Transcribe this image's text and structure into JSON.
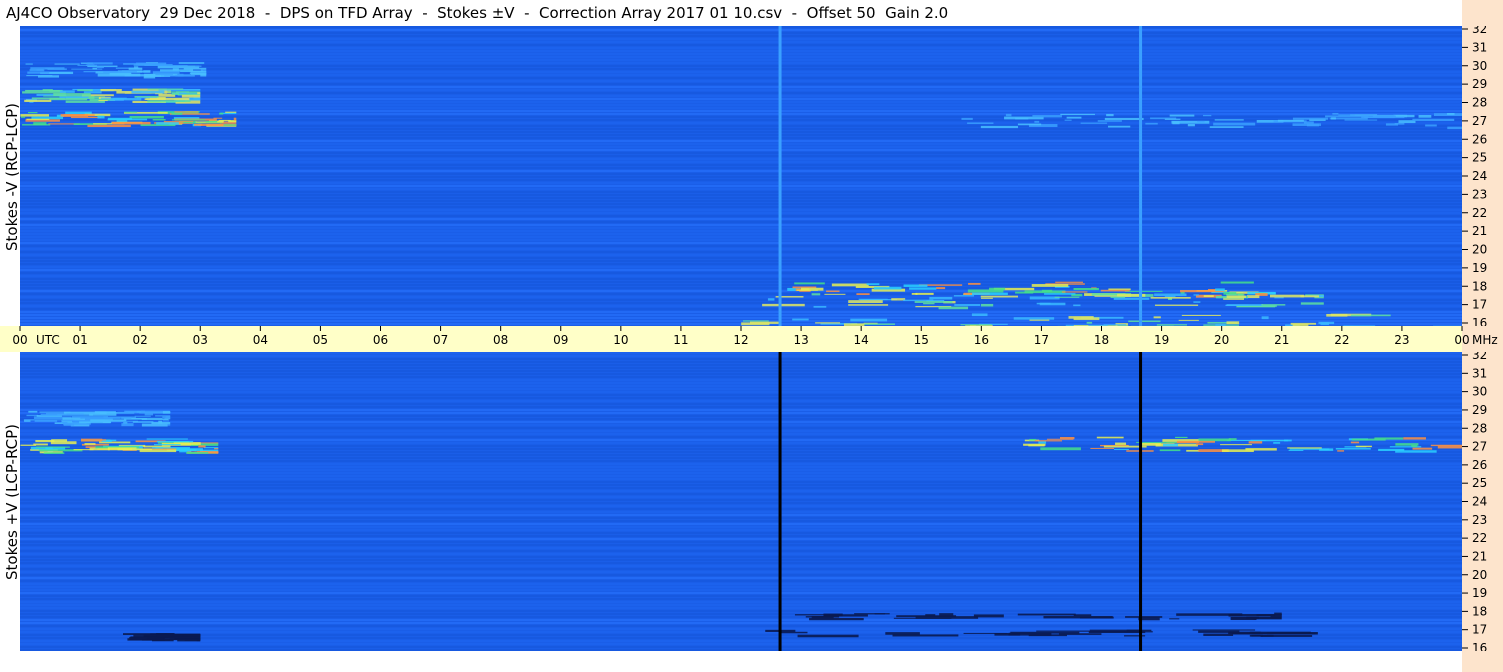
{
  "title": "AJ4CO Observatory  29 Dec 2018  -  DPS on TFD Array  -  Stokes ±V  -  Correction Array 2017 01 10.csv  -  Offset 50  Gain 2.0",
  "colors": {
    "background_blue": "#1a5ee8",
    "band_cyan": "#3aa0ff",
    "axis_bg": "#ffffc8",
    "side_bg": "#fde4cc"
  },
  "chart_data": [
    {
      "type": "heatmap",
      "panel": "top",
      "ylabel": "Stokes -V (RCP-LCP)",
      "x_axis": {
        "label": "UTC",
        "ticks": [
          "00",
          "01",
          "02",
          "03",
          "04",
          "05",
          "06",
          "07",
          "08",
          "09",
          "10",
          "11",
          "12",
          "13",
          "14",
          "15",
          "16",
          "17",
          "18",
          "19",
          "20",
          "21",
          "22",
          "23",
          "00"
        ],
        "range": [
          0,
          24
        ]
      },
      "y_axis": {
        "unit": "MHz",
        "ticks": [
          "16",
          "17",
          "18",
          "19",
          "20",
          "21",
          "22",
          "23",
          "24",
          "25",
          "26",
          "27",
          "28",
          "29",
          "30",
          "31",
          "32"
        ],
        "range": [
          16,
          32
        ]
      },
      "features": [
        {
          "kind": "activity_band",
          "freq": 27.1,
          "t_start": 0.0,
          "t_end": 3.6,
          "intensity": "high"
        },
        {
          "kind": "activity_band",
          "freq": 28.3,
          "t_start": 0.0,
          "t_end": 3.0,
          "intensity": "medium"
        },
        {
          "kind": "activity_band",
          "freq": 29.7,
          "t_start": 0.0,
          "t_end": 3.1,
          "intensity": "low"
        },
        {
          "kind": "activity_band",
          "freq": 18.0,
          "t_start": 12.6,
          "t_end": 20.9,
          "intensity": "high"
        },
        {
          "kind": "activity_band",
          "freq": 17.4,
          "t_start": 12.3,
          "t_end": 21.7,
          "intensity": "medium"
        },
        {
          "kind": "activity_band",
          "freq": 16.3,
          "t_start": 12.0,
          "t_end": 24.0,
          "intensity": "medium"
        },
        {
          "kind": "activity_band",
          "freq": 27.0,
          "t_start": 15.6,
          "t_end": 24.0,
          "intensity": "low"
        },
        {
          "kind": "vertical_line",
          "t": 12.65
        },
        {
          "kind": "vertical_line",
          "t": 18.65
        }
      ]
    },
    {
      "type": "heatmap",
      "panel": "bottom",
      "ylabel": "Stokes +V (LCP-RCP)",
      "x_axis": {
        "label": "UTC",
        "ticks": [
          "00",
          "01",
          "02",
          "03",
          "04",
          "05",
          "06",
          "07",
          "08",
          "09",
          "10",
          "11",
          "12",
          "13",
          "14",
          "15",
          "16",
          "17",
          "18",
          "19",
          "20",
          "21",
          "22",
          "23",
          "00"
        ],
        "range": [
          0,
          24
        ]
      },
      "y_axis": {
        "unit": "MHz",
        "ticks": [
          "16",
          "17",
          "18",
          "19",
          "20",
          "21",
          "22",
          "23",
          "24",
          "25",
          "26",
          "27",
          "28",
          "29",
          "30",
          "31",
          "32"
        ],
        "range": [
          16,
          32
        ]
      },
      "features": [
        {
          "kind": "activity_band",
          "freq": 27.0,
          "t_start": 0.0,
          "t_end": 3.3,
          "intensity": "high"
        },
        {
          "kind": "activity_band",
          "freq": 28.5,
          "t_start": 0.0,
          "t_end": 2.5,
          "intensity": "low"
        },
        {
          "kind": "activity_band",
          "freq": 27.1,
          "t_start": 16.5,
          "t_end": 24.0,
          "intensity": "high"
        },
        {
          "kind": "dark_band",
          "freq": 17.9,
          "t_start": 12.6,
          "t_end": 21.0
        },
        {
          "kind": "dark_band",
          "freq": 17.0,
          "t_start": 12.3,
          "t_end": 21.6
        },
        {
          "kind": "dark_band",
          "freq": 16.8,
          "t_start": 1.7,
          "t_end": 3.0
        },
        {
          "kind": "vertical_line",
          "t": 12.65
        },
        {
          "kind": "vertical_line",
          "t": 18.65
        }
      ]
    }
  ]
}
